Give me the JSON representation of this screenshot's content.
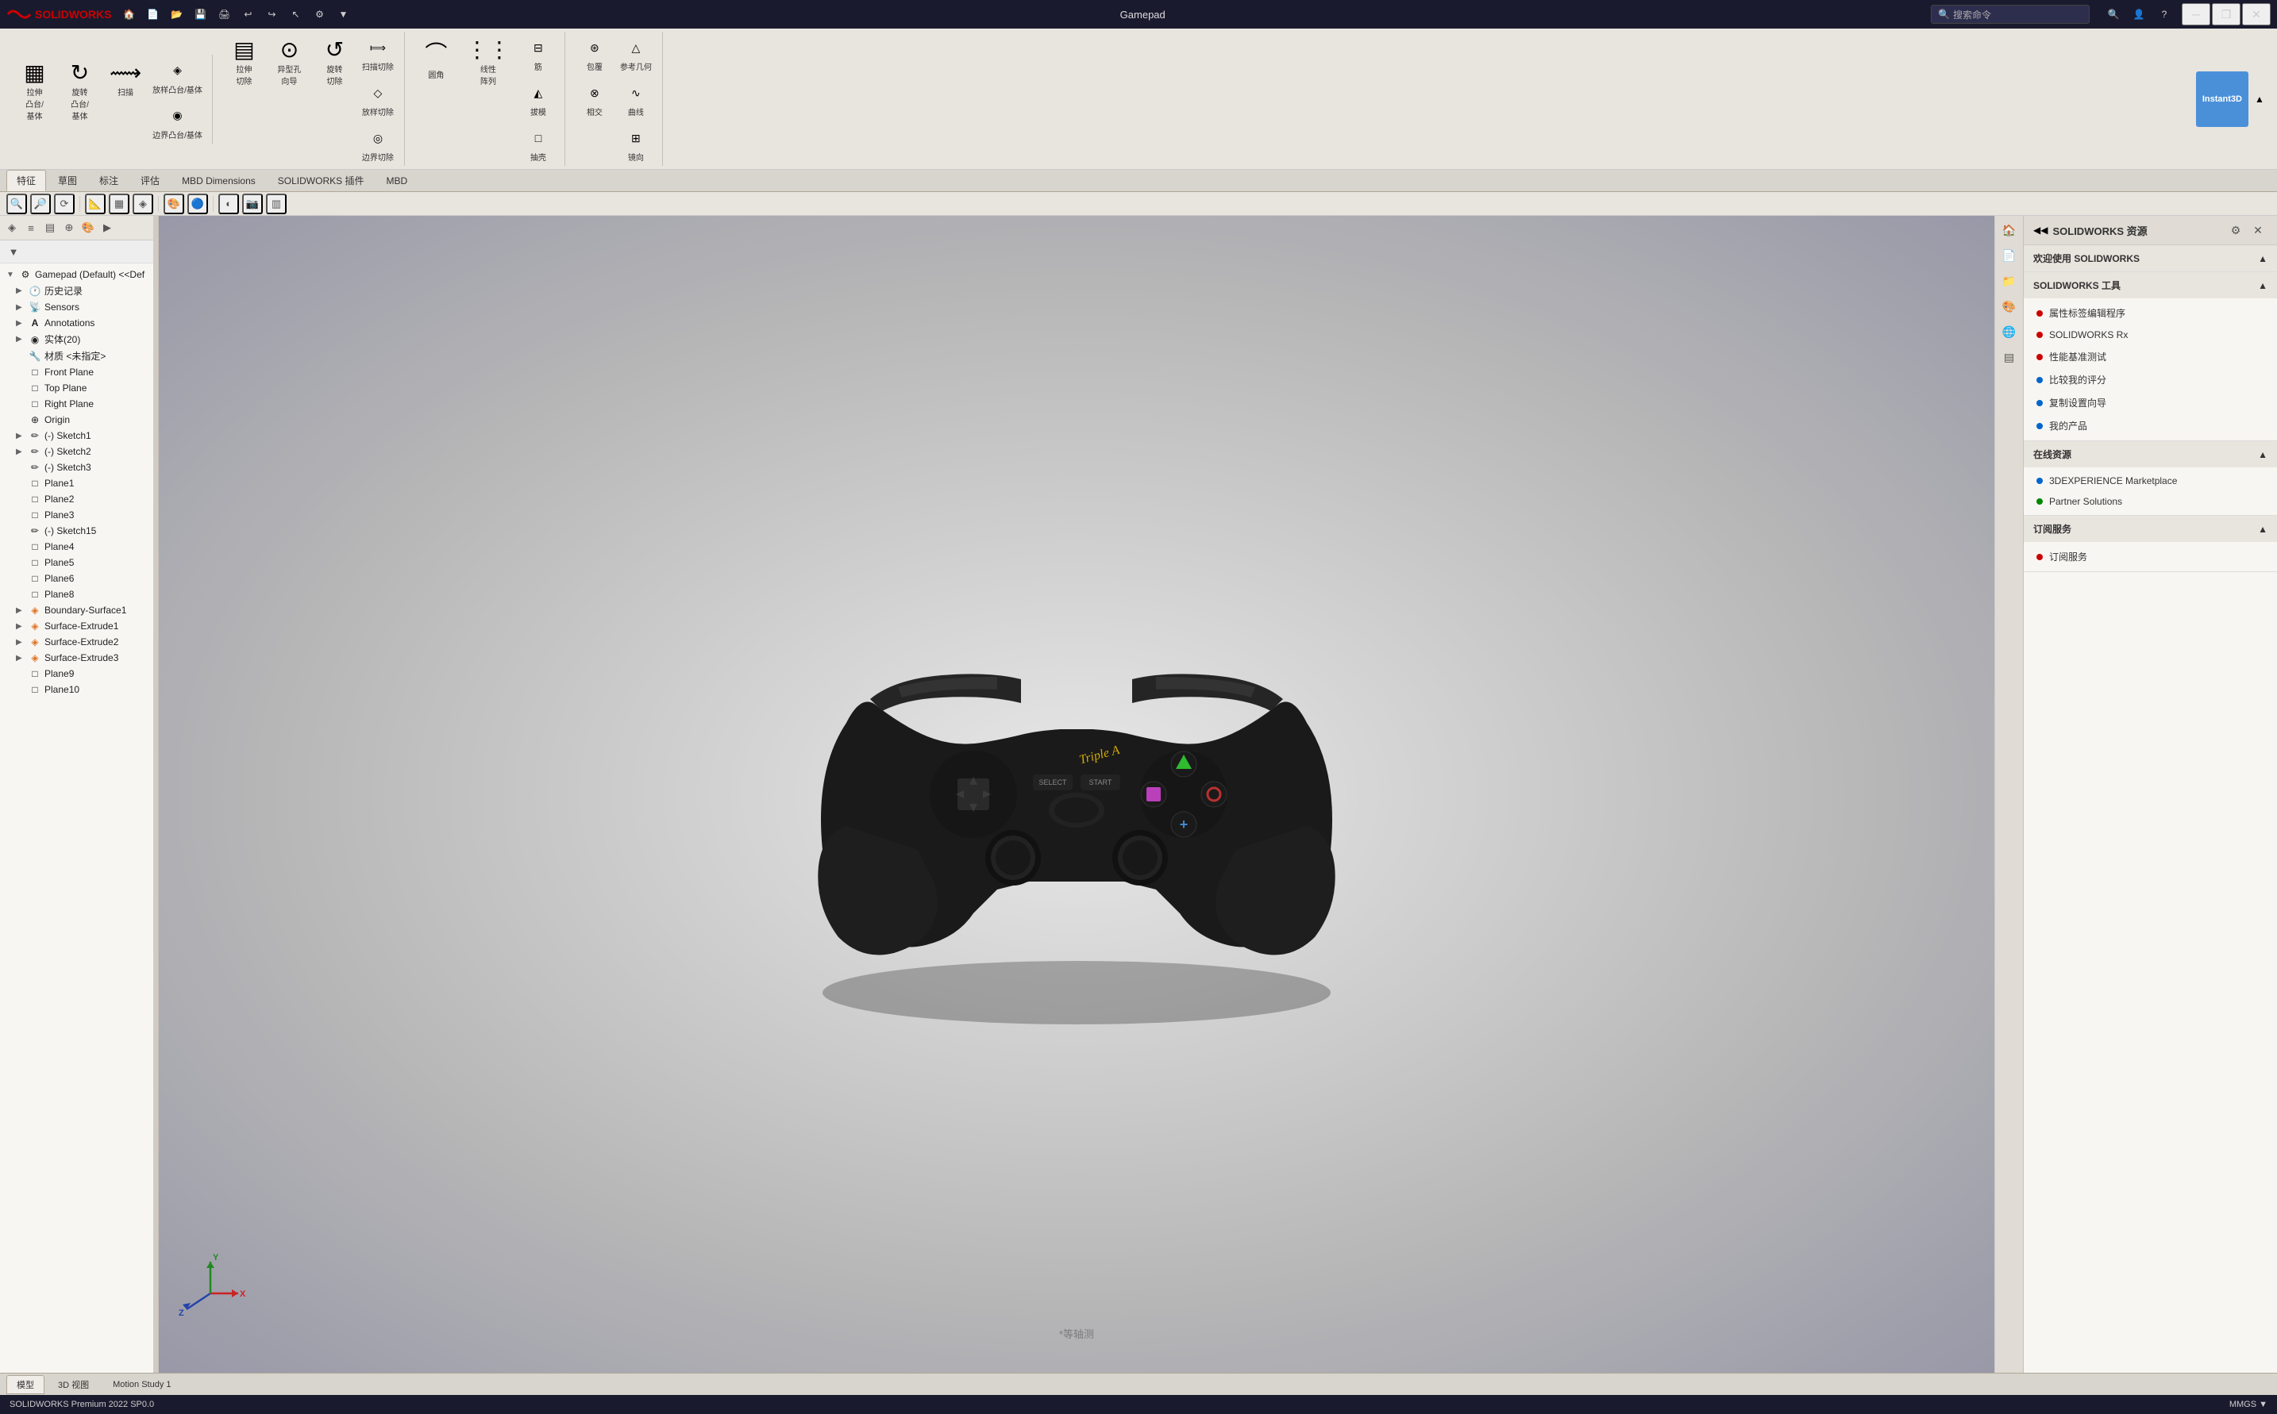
{
  "titlebar": {
    "app_name": "SOLIDWORKS",
    "title": "Gamepad",
    "search_placeholder": "搜索命令",
    "win_minimize": "─",
    "win_restore": "❐",
    "win_close": "✕"
  },
  "ribbon": {
    "groups": [
      {
        "buttons": [
          {
            "label": "拉伸\n凸台/\n基体",
            "icon": "▦"
          },
          {
            "label": "旋转\n凸台/\n基体",
            "icon": "↻"
          },
          {
            "label": "扫描",
            "icon": "⟿"
          },
          {
            "label": "放样凸台/基体",
            "icon": "◈"
          },
          {
            "label": "边界凸台/基体",
            "icon": "◉"
          }
        ]
      },
      {
        "buttons": [
          {
            "label": "拉伸\n切除",
            "icon": "▤"
          },
          {
            "label": "异型孔\n向导",
            "icon": "⊙"
          },
          {
            "label": "旋转\n切除",
            "icon": "↺"
          },
          {
            "label": "扫描切除",
            "icon": "⟾"
          },
          {
            "label": "放样切除",
            "icon": "◇"
          },
          {
            "label": "边界切除",
            "icon": "◎"
          }
        ]
      },
      {
        "buttons": [
          {
            "label": "圆角",
            "icon": "⌒"
          },
          {
            "label": "线性\n阵列",
            "icon": "⋮⋮"
          },
          {
            "label": "筋",
            "icon": "⊟"
          },
          {
            "label": "拔模",
            "icon": "◭"
          },
          {
            "label": "抽壳",
            "icon": "□"
          }
        ]
      },
      {
        "buttons": [
          {
            "label": "包覆",
            "icon": "⊛"
          },
          {
            "label": "相交",
            "icon": "⊗"
          },
          {
            "label": "参考几何",
            "icon": "△"
          },
          {
            "label": "曲线",
            "icon": "∿"
          },
          {
            "label": "镜向",
            "icon": "⊞"
          }
        ]
      }
    ],
    "instant3d": "Instant3D"
  },
  "tabs": {
    "items": [
      "特征",
      "草图",
      "标注",
      "评估",
      "MBD Dimensions",
      "SOLIDWORKS 插件",
      "MBD"
    ],
    "active": "特征"
  },
  "secondary_toolbar": {
    "icons": [
      "🔍",
      "🔎",
      "⟳",
      "📐",
      "📏",
      "🎯",
      "⬡",
      "◉",
      "🔵",
      "⚙",
      "📷",
      "▥"
    ]
  },
  "feature_tree": {
    "icons_row": [
      "◈",
      "≡",
      "▤",
      "⊕",
      "🎨",
      "▶"
    ],
    "filter_label": "▼",
    "root": "Gamepad (Default) <<Def",
    "items": [
      {
        "label": "历史记录",
        "icon": "🕐",
        "indent": 1,
        "arrow": "▶"
      },
      {
        "label": "Sensors",
        "icon": "📡",
        "indent": 1,
        "arrow": "▶"
      },
      {
        "label": "Annotations",
        "icon": "A",
        "indent": 1,
        "arrow": "▶"
      },
      {
        "label": "实体(20)",
        "icon": "◉",
        "indent": 1,
        "arrow": "▶"
      },
      {
        "label": "材质 <未指定>",
        "icon": "🔧",
        "indent": 1,
        "arrow": ""
      },
      {
        "label": "Front Plane",
        "icon": "□",
        "indent": 1,
        "arrow": ""
      },
      {
        "label": "Top Plane",
        "icon": "□",
        "indent": 1,
        "arrow": ""
      },
      {
        "label": "Right Plane",
        "icon": "□",
        "indent": 1,
        "arrow": ""
      },
      {
        "label": "Origin",
        "icon": "⊕",
        "indent": 1,
        "arrow": ""
      },
      {
        "label": "(-) Sketch1",
        "icon": "✏",
        "indent": 1,
        "arrow": "▶"
      },
      {
        "label": "(-) Sketch2",
        "icon": "✏",
        "indent": 1,
        "arrow": "▶"
      },
      {
        "label": "(-) Sketch3",
        "icon": "✏",
        "indent": 1,
        "arrow": ""
      },
      {
        "label": "Plane1",
        "icon": "□",
        "indent": 1,
        "arrow": ""
      },
      {
        "label": "Plane2",
        "icon": "□",
        "indent": 1,
        "arrow": ""
      },
      {
        "label": "Plane3",
        "icon": "□",
        "indent": 1,
        "arrow": ""
      },
      {
        "label": "(-) Sketch15",
        "icon": "✏",
        "indent": 1,
        "arrow": ""
      },
      {
        "label": "Plane4",
        "icon": "□",
        "indent": 1,
        "arrow": ""
      },
      {
        "label": "Plane5",
        "icon": "□",
        "indent": 1,
        "arrow": ""
      },
      {
        "label": "Plane6",
        "icon": "□",
        "indent": 1,
        "arrow": ""
      },
      {
        "label": "Plane8",
        "icon": "□",
        "indent": 1,
        "arrow": ""
      },
      {
        "label": "Boundary-Surface1",
        "icon": "◈",
        "indent": 1,
        "arrow": "▶"
      },
      {
        "label": "Surface-Extrude1",
        "icon": "◈",
        "indent": 1,
        "arrow": "▶"
      },
      {
        "label": "Surface-Extrude2",
        "icon": "◈",
        "indent": 1,
        "arrow": "▶"
      },
      {
        "label": "Surface-Extrude3",
        "icon": "◈",
        "indent": 1,
        "arrow": "▶"
      },
      {
        "label": "Plane9",
        "icon": "□",
        "indent": 1,
        "arrow": ""
      },
      {
        "label": "Plane10",
        "icon": "□",
        "indent": 1,
        "arrow": ""
      }
    ]
  },
  "right_panel": {
    "title": "SOLIDWORKS 资源",
    "sections": [
      {
        "title": "欢迎使用 SOLIDWORKS",
        "items": []
      },
      {
        "title": "SOLIDWORKS 工具",
        "items": [
          {
            "label": "属性标签编辑程序",
            "dot_color": "red"
          },
          {
            "label": "SOLIDWORKS Rx",
            "dot_color": "red"
          },
          {
            "label": "性能基准测试",
            "dot_color": "red"
          },
          {
            "label": "比较我的评分",
            "dot_color": "blue"
          },
          {
            "label": "复制设置向导",
            "dot_color": "blue"
          },
          {
            "label": "我的产品",
            "dot_color": "blue"
          }
        ]
      },
      {
        "title": "在线资源",
        "items": [
          {
            "label": "3DEXPERIENCE Marketplace",
            "dot_color": "blue"
          },
          {
            "label": "Partner Solutions",
            "dot_color": "green"
          }
        ]
      },
      {
        "title": "订阅服务",
        "items": [
          {
            "label": "订阅服务",
            "dot_color": "red"
          }
        ]
      }
    ]
  },
  "bottom_tabs": {
    "items": [
      "模型",
      "3D 视图",
      "Motion Study 1"
    ],
    "active": "模型"
  },
  "status_bar": {
    "left": "SOLIDWORKS Premium 2022 SP0.0",
    "right": "MMGS ▼"
  },
  "viewport": {
    "watermark": "*等轴测"
  },
  "coord_labels": {
    "x": "X",
    "y": "Y",
    "z": "Z"
  }
}
